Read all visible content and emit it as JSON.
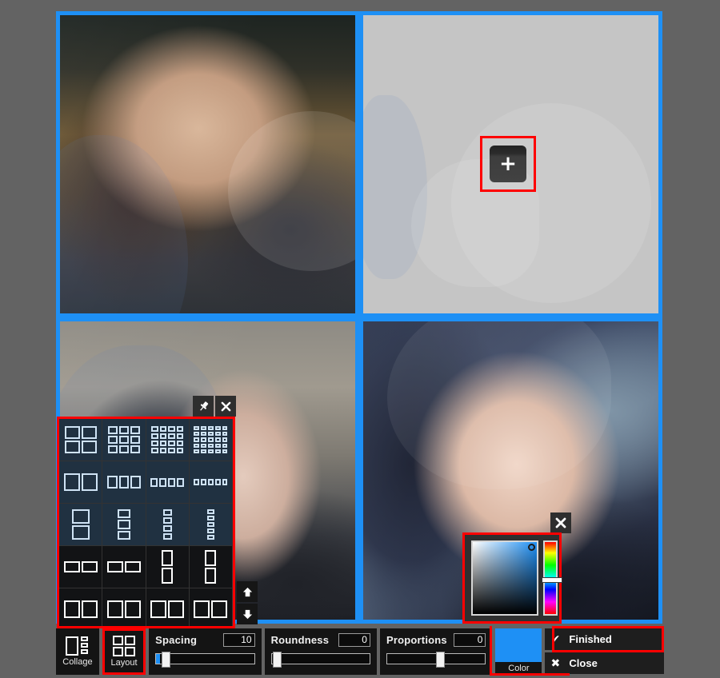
{
  "app": {
    "background_color": "#636363",
    "accent_color": "#1e90f5",
    "annotation_color": "#ff0000"
  },
  "collage": {
    "border_color": "#1e90f5",
    "spacing_color": "#1e90f5",
    "cells": [
      {
        "name": "photo-cell-1",
        "state": "filled",
        "description": "portrait-woman-long-hair"
      },
      {
        "name": "photo-cell-2",
        "state": "empty",
        "background_color": "#c5c5c5"
      },
      {
        "name": "photo-cell-3",
        "state": "filled",
        "description": "portrait-woman-hood-stone-wall"
      },
      {
        "name": "photo-cell-4",
        "state": "filled",
        "description": "portrait-woman-blue-hood-closeup"
      }
    ],
    "add_photo": {
      "icon": "plus-icon",
      "glyph": "+",
      "highlighted": true
    }
  },
  "layout_panel": {
    "title_buttons": [
      {
        "name": "pin-icon",
        "label": "Pin"
      },
      {
        "name": "close-icon",
        "label": "Close"
      }
    ],
    "highlighted": true,
    "scroll": {
      "up": {
        "name": "scroll-up-icon",
        "glyph": "⬆"
      },
      "down": {
        "name": "scroll-down-icon",
        "glyph": "⬇"
      }
    },
    "rows": [
      {
        "tint": "blue",
        "items": [
          {
            "name": "layout-grid-2x2",
            "cols": 2,
            "rows": 2,
            "w": 40,
            "h": 34,
            "selected": true
          },
          {
            "name": "layout-grid-3x3",
            "cols": 3,
            "rows": 3,
            "w": 40,
            "h": 34,
            "selected": false
          },
          {
            "name": "layout-grid-4x4",
            "cols": 4,
            "rows": 4,
            "w": 40,
            "h": 34,
            "selected": false
          },
          {
            "name": "layout-grid-5x5",
            "cols": 5,
            "rows": 5,
            "w": 42,
            "h": 34,
            "selected": false
          }
        ]
      },
      {
        "tint": "blue",
        "items": [
          {
            "name": "layout-cols-2",
            "cols": 2,
            "rows": 1,
            "w": 42,
            "h": 22,
            "selected": false
          },
          {
            "name": "layout-cols-3",
            "cols": 3,
            "rows": 1,
            "w": 42,
            "h": 16,
            "selected": false
          },
          {
            "name": "layout-cols-4",
            "cols": 4,
            "rows": 1,
            "w": 42,
            "h": 11,
            "selected": false
          },
          {
            "name": "layout-cols-5",
            "cols": 5,
            "rows": 1,
            "w": 42,
            "h": 8,
            "selected": false
          }
        ]
      },
      {
        "tint": "blue",
        "items": [
          {
            "name": "layout-rows-2",
            "cols": 1,
            "rows": 2,
            "w": 22,
            "h": 38,
            "selected": false
          },
          {
            "name": "layout-rows-3",
            "cols": 1,
            "rows": 3,
            "w": 16,
            "h": 38,
            "selected": false
          },
          {
            "name": "layout-rows-4",
            "cols": 1,
            "rows": 4,
            "w": 11,
            "h": 38,
            "selected": false
          },
          {
            "name": "layout-rows-5",
            "cols": 1,
            "rows": 5,
            "w": 9,
            "h": 38,
            "selected": false
          }
        ]
      },
      {
        "tint": "dark",
        "items": [
          {
            "name": "layout-split-wide-left",
            "cols": 2,
            "rows": 1,
            "w": 42,
            "h": 14,
            "selected": false
          },
          {
            "name": "layout-split-wide-right",
            "cols": 2,
            "rows": 1,
            "w": 42,
            "h": 14,
            "selected": false
          },
          {
            "name": "layout-split-tall-top",
            "cols": 1,
            "rows": 2,
            "w": 14,
            "h": 42,
            "selected": false
          },
          {
            "name": "layout-split-tall-bottom",
            "cols": 1,
            "rows": 2,
            "w": 14,
            "h": 42,
            "selected": false
          }
        ]
      },
      {
        "tint": "dark",
        "items": [
          {
            "name": "layout-partial-a",
            "cols": 2,
            "rows": 1,
            "w": 42,
            "h": 22,
            "selected": false
          },
          {
            "name": "layout-partial-b",
            "cols": 2,
            "rows": 1,
            "w": 42,
            "h": 22,
            "selected": false
          },
          {
            "name": "layout-partial-c",
            "cols": 2,
            "rows": 1,
            "w": 42,
            "h": 22,
            "selected": false
          },
          {
            "name": "layout-partial-d",
            "cols": 2,
            "rows": 1,
            "w": 42,
            "h": 22,
            "selected": false
          }
        ]
      }
    ]
  },
  "color_popup": {
    "highlighted": true,
    "close": {
      "name": "close-icon",
      "glyph": "✕"
    },
    "selected_color": "#1e90f5",
    "sv_square": {
      "name": "saturation-value-square"
    },
    "hue_strip": {
      "name": "hue-strip"
    }
  },
  "toolbar": {
    "collage": {
      "label": "Collage",
      "icon": "collage-icon",
      "selected": false
    },
    "layout": {
      "label": "Layout",
      "icon": "layout-grid-icon",
      "selected": true
    },
    "sliders": [
      {
        "name": "spacing",
        "label": "Spacing",
        "value": "10",
        "handle_pct": 6,
        "fill_pct": 4
      },
      {
        "name": "roundness",
        "label": "Roundness",
        "value": "0",
        "handle_pct": 1,
        "fill_pct": 0
      },
      {
        "name": "proportions",
        "label": "Proportions",
        "value": "0",
        "handle_pct": 50,
        "fill_pct": 0
      }
    ],
    "color": {
      "label": "Color",
      "value": "#1e90f5"
    },
    "actions": [
      {
        "name": "finished-button",
        "label": "Finished",
        "glyph": "✔",
        "highlighted": true
      },
      {
        "name": "close-button",
        "label": "Close",
        "glyph": "✖",
        "highlighted": false
      }
    ]
  }
}
